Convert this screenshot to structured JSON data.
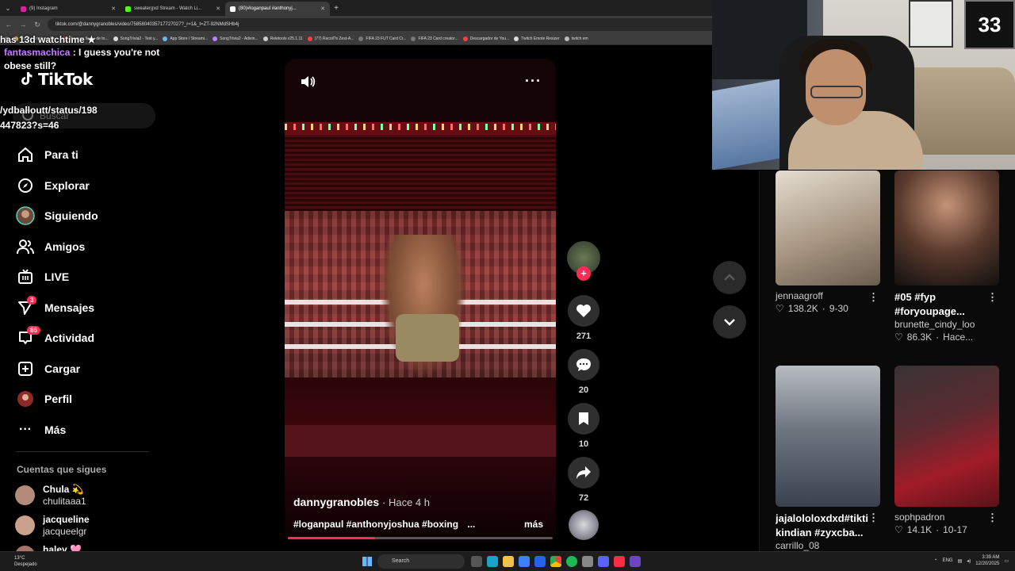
{
  "browser": {
    "tabs": [
      {
        "label": "(9) Instagram",
        "color": "#d6249f"
      },
      {
        "label": "sweatergxd Stream - Watch Li...",
        "color": "#53fc18"
      },
      {
        "label": "(80)#loganpaul #anthonyj...",
        "color": "#ffffff"
      }
    ],
    "url": "tiktok.com/@dannygranobles/video/7585804035717727027?_r=1&_t=ZT-92NMdSHb4j",
    "bookmarks": [
      "Happy Cristiano Ro...",
      "Burrego figura de to...",
      "SongTrivia2 - Test y...",
      "App Store / Streami...",
      "SongTrivia2 - Adivin...",
      "Reletools v25.1.11",
      "(77) Racoll?s Zest-A...",
      "FIFA 23 FUT Card Cr...",
      "FIFA 23 Card creator...",
      "Descargador de You...",
      "Twitch Emote Resizer",
      "twitch em"
    ]
  },
  "chat": {
    "header": "has 13d watchtime ★",
    "username": "fantasmachica",
    "message": ": I guess you're not obese still?",
    "tweet_line1": "/ydballoutt/status/198",
    "tweet_line2": "447823?s=46"
  },
  "sidebar": {
    "logo": "TikTok",
    "search_placeholder": "Buscar",
    "items": [
      {
        "label": "Para ti",
        "icon": "home-icon"
      },
      {
        "label": "Explorar",
        "icon": "compass-icon"
      },
      {
        "label": "Siguiendo",
        "icon": "following-avatar-icon"
      },
      {
        "label": "Amigos",
        "icon": "friends-icon"
      },
      {
        "label": "LIVE",
        "icon": "live-tv-icon"
      },
      {
        "label": "Mensajes",
        "icon": "send-icon",
        "badge": "3"
      },
      {
        "label": "Actividad",
        "icon": "inbox-icon",
        "badge": "86"
      },
      {
        "label": "Cargar",
        "icon": "upload-plus-icon"
      },
      {
        "label": "Perfil",
        "icon": "profile-avatar-icon"
      },
      {
        "label": "Más",
        "icon": "more-dots-icon"
      }
    ],
    "following_title": "Cuentas que sigues",
    "following": [
      {
        "name": "Chula 💫",
        "handle": "chulitaaa1",
        "color": "#b48a78"
      },
      {
        "name": "jacqueline",
        "handle": "jacqueelgr",
        "color": "#c9a08a"
      },
      {
        "name": "haley 🩷",
        "handle": "",
        "color": "#a57466"
      }
    ]
  },
  "video": {
    "author": "dannygranobles",
    "time": "· Hace 4 h",
    "tags": "#loganpaul #anthonyjoshua #boxing",
    "ellipsis": "...",
    "more": "más",
    "progress": 0.33
  },
  "actions": {
    "likes": "271",
    "comments": "20",
    "saves": "10",
    "shares": "72"
  },
  "feed": [
    {
      "title": "",
      "user": "jennaagroff",
      "likes": "138.2K",
      "date": "9-30",
      "colors": [
        "#d8d2c8",
        "#8e8272"
      ]
    },
    {
      "title": "#05 #fyp #foryoupage...",
      "user": "brunette_cindy_loo",
      "likes": "86.3K",
      "date": "Hace...",
      "colors": [
        "#4a3a33",
        "#1a1412"
      ]
    },
    {
      "title": "jajalololoxdxd#tiktikindian #zyxcba...",
      "user": "carrillo_08",
      "likes": "",
      "date": "",
      "colors": [
        "#9aa0a6",
        "#3b4452"
      ]
    },
    {
      "title": "",
      "user": "sophpadron",
      "likes": "14.1K",
      "date": "10-17",
      "colors": [
        "#8b1a22",
        "#2d2b2e"
      ]
    }
  ],
  "webcam": {
    "jersey_number": "33"
  },
  "taskbar": {
    "temp": "13°C",
    "condition": "Despejado",
    "search": "Search",
    "lang": "ENG",
    "time": "3:39 AM",
    "date": "12/20/2025"
  }
}
